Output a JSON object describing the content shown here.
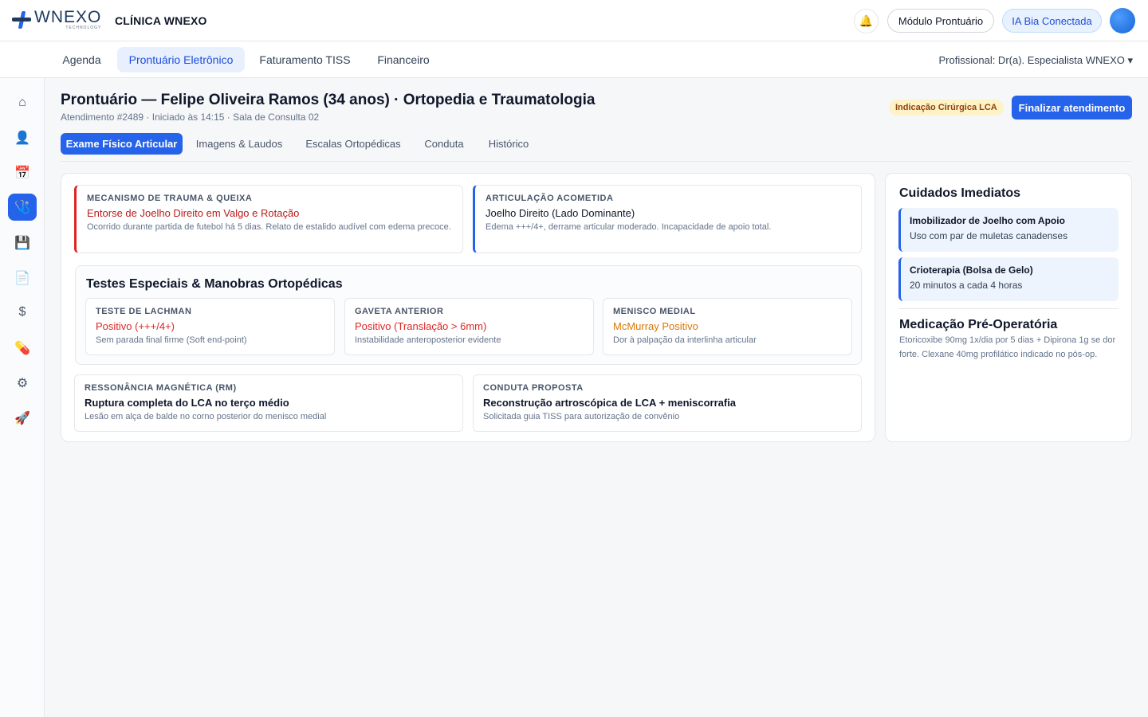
{
  "brand": {
    "logo_text": "WNEXO",
    "logo_sub": "TECHNOLOGY",
    "clinic": "CLÍNICA WNEXO"
  },
  "topbar": {
    "module_label": "Módulo Prontuário",
    "ia_label": "IA Bia Conectada",
    "bell_icon": "bell-icon"
  },
  "nav": {
    "tabs": [
      "Agenda",
      "Prontuário Eletrônico",
      "Faturamento TISS",
      "Financeiro"
    ],
    "active_tab": "Prontuário Eletrônico",
    "professional": "Profissional: Dr(a). Especialista WNEXO ▾"
  },
  "sidebar": {
    "items": [
      {
        "icon": "home-icon",
        "glyph": "⌂"
      },
      {
        "icon": "user-icon",
        "glyph": "👤"
      },
      {
        "icon": "calendar-icon",
        "glyph": "📅"
      },
      {
        "icon": "medical-record-icon",
        "glyph": "🩺",
        "active": true
      },
      {
        "icon": "save-icon",
        "glyph": "💾"
      },
      {
        "icon": "document-icon",
        "glyph": "📄"
      },
      {
        "icon": "dollar-icon",
        "glyph": "$"
      },
      {
        "icon": "pill-icon",
        "glyph": "💊"
      },
      {
        "icon": "settings-icon",
        "glyph": "⚙"
      },
      {
        "icon": "rocket-icon",
        "glyph": "🚀"
      }
    ]
  },
  "header": {
    "title": "Prontuário — Felipe Oliveira Ramos (34 anos) · Ortopedia e Traumatologia",
    "subtitle": "Atendimento #2489 · Iniciado às 14:15 · Sala de Consulta 02",
    "badge": "Indicação Cirúrgica LCA",
    "finish_button": "Finalizar atendimento"
  },
  "subtabs": [
    "Exame Físico Articular",
    "Imagens & Laudos",
    "Escalas Ortopédicas",
    "Conduta",
    "Histórico"
  ],
  "main": {
    "trauma": {
      "label": "Mecanismo de Trauma & Queixa",
      "value": "Entorse de Joelho Direito em Valgo e Rotação",
      "desc": "Ocorrido durante partida de futebol há 5 dias. Relato de estalido audível com edema precoce."
    },
    "joint": {
      "label": "Articulação Acometida",
      "value": "Joelho Direito (Lado Dominante)",
      "desc": "Edema +++/4+, derrame articular moderado. Incapacidade de apoio total."
    },
    "tests_title": "Testes Especiais & Manobras Ortopédicas",
    "tests": [
      {
        "label": "Teste de Lachman",
        "value": "Positivo (+++/4+)",
        "desc": "Sem parada final firme (Soft end-point)"
      },
      {
        "label": "Gaveta Anterior",
        "value": "Positivo (Translação > 6mm)",
        "desc": "Instabilidade anteroposterior evidente"
      },
      {
        "label": "Menisco Medial",
        "value": "McMurray Positivo",
        "desc": "Dor à palpação da interlinha articular"
      }
    ],
    "mri": {
      "label": "Ressonância Magnética (RM)",
      "value": "Ruptura completa do LCA no terço médio",
      "desc": "Lesão em alça de balde no corno posterior do menisco medial"
    },
    "plan": {
      "label": "Conduta Proposta",
      "value": "Reconstrução artroscópica de LCA + meniscorrafia",
      "desc": "Solicitada guia TISS para autorização de convênio"
    }
  },
  "side": {
    "title": "Cuidados Imediatos",
    "cares": [
      {
        "title": "Imobilizador de Joelho com Apoio",
        "desc": "Uso com par de muletas canadenses"
      },
      {
        "title": "Crioterapia (Bolsa de Gelo)",
        "desc": "20 minutos a cada 4 horas"
      }
    ],
    "med_title": "Medicação Pré-Operatória",
    "med_text": "Etoricoxibe 90mg 1x/dia por 5 dias + Dipirona 1g se dor forte. Clexane 40mg profilático indicado no pós-op."
  }
}
